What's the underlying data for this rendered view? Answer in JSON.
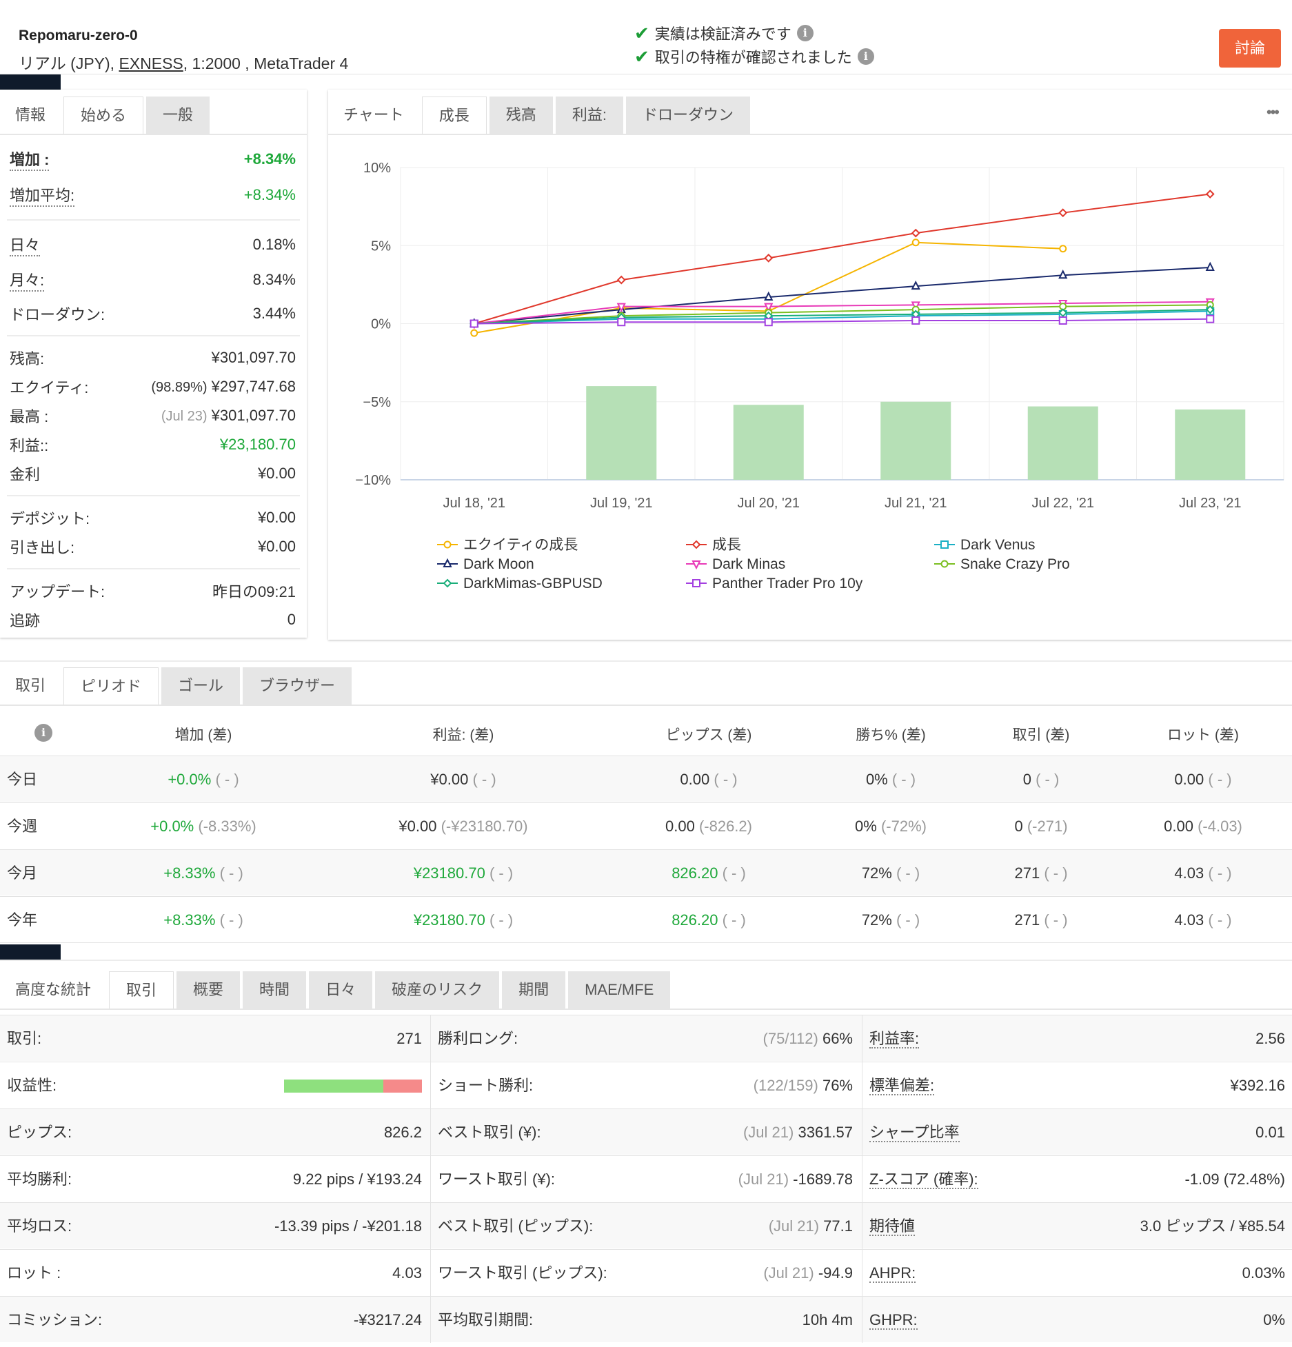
{
  "header": {
    "account_name": "Repomaru-zero-0",
    "account_type": "リアル (JPY), ",
    "broker": "EXNESS",
    "account_rest": ", 1:2000 , MetaTrader 4",
    "verify1": "実績は検証済みです",
    "verify2": "取引の特権が確認されました",
    "discuss": "討論"
  },
  "left_tabs": [
    "情報",
    "始める",
    "一般"
  ],
  "summary": {
    "gain_label": "増加 :",
    "gain_value": "+8.34%",
    "abs_gain_label": "増加平均:",
    "abs_gain_value": "+8.34%",
    "daily_label": "日々",
    "daily_value": "0.18%",
    "monthly_label": "月々:",
    "monthly_value": "8.34%",
    "drawdown_label": "ドローダウン:",
    "drawdown_value": "3.44%",
    "balance_label": "残高:",
    "balance_value": "¥301,097.70",
    "equity_label": "エクイティ:",
    "equity_pct": "(98.89%)",
    "equity_value": "¥297,747.68",
    "highest_label": "最高 :",
    "highest_date": "(Jul 23)",
    "highest_value": "¥301,097.70",
    "profit_label": "利益::",
    "profit_value": "¥23,180.70",
    "interest_label": "金利",
    "interest_value": "¥0.00",
    "deposits_label": "デポジット:",
    "deposits_value": "¥0.00",
    "withdrawals_label": "引き出し:",
    "withdrawals_value": "¥0.00",
    "updated_label": "アップデート:",
    "updated_value": "昨日の09:21",
    "tracking_label": "追跡",
    "tracking_value": "0"
  },
  "chart_tabs": [
    "チャート",
    "成長",
    "残高",
    "利益:",
    "ドローダウン"
  ],
  "chart_menu": "•••",
  "chart_data": {
    "type": "line",
    "x": [
      "Jul 18, '21",
      "Jul 19, '21",
      "Jul 20, '21",
      "Jul 21, '21",
      "Jul 22, '21",
      "Jul 23, '21"
    ],
    "y_ticks": [
      "10%",
      "5%",
      "0%",
      "−5%",
      "−10%"
    ],
    "ylim": [
      -10,
      10
    ],
    "series": [
      {
        "name": "エクイティの成長",
        "color": "#f5b400",
        "marker": "circle",
        "values": [
          -0.6,
          1.0,
          0.8,
          5.2,
          4.8,
          null
        ]
      },
      {
        "name": "成長",
        "color": "#e0382c",
        "marker": "diamond",
        "values": [
          0,
          2.8,
          4.2,
          5.8,
          7.1,
          8.3
        ]
      },
      {
        "name": "Dark Venus",
        "color": "#1bb0c5",
        "marker": "square",
        "values": [
          0,
          0.3,
          0.3,
          0.5,
          0.6,
          0.8
        ]
      },
      {
        "name": "Dark Moon",
        "color": "#1a2a6c",
        "marker": "triangle",
        "values": [
          0,
          0.9,
          1.7,
          2.4,
          3.1,
          3.6
        ]
      },
      {
        "name": "Dark Minas",
        "color": "#e83ab8",
        "marker": "triangle-down",
        "values": [
          0,
          1.1,
          1.1,
          1.2,
          1.3,
          1.4
        ]
      },
      {
        "name": "Snake Crazy Pro",
        "color": "#7bbf21",
        "marker": "circle",
        "values": [
          0,
          0.5,
          0.7,
          0.9,
          1.1,
          1.2
        ]
      },
      {
        "name": "DarkMimas-GBPUSD",
        "color": "#1aae7a",
        "marker": "diamond",
        "values": [
          0,
          0.4,
          0.5,
          0.6,
          0.7,
          0.9
        ]
      },
      {
        "name": "Panther Trader Pro 10y",
        "color": "#a340e0",
        "marker": "square",
        "values": [
          0,
          0.1,
          0.1,
          0.2,
          0.2,
          0.3
        ]
      }
    ],
    "bars": {
      "color": "#b6e0b6",
      "values": [
        0,
        6.0,
        4.8,
        5.0,
        4.7,
        4.5
      ]
    }
  },
  "period_tabs": [
    "取引",
    "ピリオド",
    "ゴール",
    "ブラウザー"
  ],
  "period_table": {
    "headers": [
      "増加 (差)",
      "利益: (差)",
      "ピップス (差)",
      "勝ち% (差)",
      "取引 (差)",
      "ロット (差)"
    ],
    "rows": [
      {
        "label": "今日",
        "cells": [
          [
            "+0.0%",
            "( - )"
          ],
          [
            "¥0.00",
            "( - )"
          ],
          [
            "0.00",
            "( - )"
          ],
          [
            "0%",
            "( - )"
          ],
          [
            "0",
            "( - )"
          ],
          [
            "0.00",
            "( - )"
          ]
        ]
      },
      {
        "label": "今週",
        "cells": [
          [
            "+0.0%",
            "(-8.33%)"
          ],
          [
            "¥0.00",
            "(-¥23180.70)"
          ],
          [
            "0.00",
            "(-826.2)"
          ],
          [
            "0%",
            "(-72%)"
          ],
          [
            "0",
            "(-271)"
          ],
          [
            "0.00",
            "(-4.03)"
          ]
        ]
      },
      {
        "label": "今月",
        "cells": [
          [
            "+8.33%",
            "( - )"
          ],
          [
            "¥23180.70",
            "( - )"
          ],
          [
            "826.20",
            "( - )"
          ],
          [
            "72%",
            "( - )"
          ],
          [
            "271",
            "( - )"
          ],
          [
            "4.03",
            "( - )"
          ]
        ]
      },
      {
        "label": "今年",
        "cells": [
          [
            "+8.33%",
            "( - )"
          ],
          [
            "¥23180.70",
            "( - )"
          ],
          [
            "826.20",
            "( - )"
          ],
          [
            "72%",
            "( - )"
          ],
          [
            "271",
            "( - )"
          ],
          [
            "4.03",
            "( - )"
          ]
        ]
      }
    ]
  },
  "stats_tabs": [
    "高度な統計",
    "取引",
    "概要",
    "時間",
    "日々",
    "破産のリスク",
    "期間",
    "MAE/MFE"
  ],
  "stats": {
    "col1": [
      {
        "label": "取引:",
        "value": "271"
      },
      {
        "label": "収益性:",
        "value": ""
      },
      {
        "label": "ピップス:",
        "value": "826.2"
      },
      {
        "label": "平均勝利:",
        "value": "9.22 pips / ¥193.24"
      },
      {
        "label": "平均ロス:",
        "value": "-13.39 pips / -¥201.18"
      },
      {
        "label": "ロット :",
        "value": "4.03"
      },
      {
        "label": "コミッション:",
        "value": "-¥3217.24"
      }
    ],
    "col2": [
      {
        "label": "勝利ロング:",
        "sub": "(75/112)",
        "value": "66%"
      },
      {
        "label": "ショート勝利:",
        "sub": "(122/159)",
        "value": "76%"
      },
      {
        "label": "ベスト取引 (¥):",
        "sub": "(Jul 21)",
        "value": "3361.57"
      },
      {
        "label": "ワースト取引 (¥):",
        "sub": "(Jul 21)",
        "value": "-1689.78"
      },
      {
        "label": "ベスト取引 (ピップス):",
        "sub": "(Jul 21)",
        "value": "77.1"
      },
      {
        "label": "ワースト取引 (ピップス):",
        "sub": "(Jul 21)",
        "value": "-94.9"
      },
      {
        "label": "平均取引期間:",
        "sub": "",
        "value": "10h 4m"
      }
    ],
    "col3": [
      {
        "label": "利益率:",
        "value": "2.56"
      },
      {
        "label": "標準偏差:",
        "value": "¥392.16"
      },
      {
        "label": "シャープ比率",
        "value": "0.01"
      },
      {
        "label": "Z-スコア (確率):",
        "value": "-1.09 (72.48%)"
      },
      {
        "label": "期待値",
        "value": "3.0 ピップス / ¥85.54"
      },
      {
        "label": "AHPR:",
        "value": "0.03%"
      },
      {
        "label": "GHPR:",
        "value": "0%"
      }
    ],
    "profitability_win_fraction": 0.72
  }
}
